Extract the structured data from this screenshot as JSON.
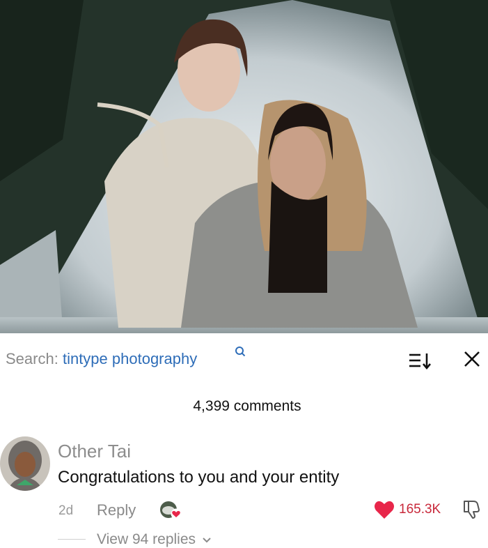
{
  "photo": {
    "description_icon": "photo-two-women-snow-hut"
  },
  "search": {
    "prefix": "Search:",
    "query": "tintype photography",
    "icon": "search-icon"
  },
  "toolbar": {
    "sort_icon": "sort-icon",
    "close_icon": "close-icon"
  },
  "comments": {
    "count_label": "4,399 comments"
  },
  "comment": {
    "author": "Other Tai",
    "text": "Congratulations to you and your entity",
    "age": "2d",
    "reply_label": "Reply",
    "like_count": "165.3K",
    "view_replies_label": "View 94 replies"
  },
  "colors": {
    "like": "#e8264a",
    "link": "#2e6db8",
    "muted": "#8a8a8a"
  }
}
